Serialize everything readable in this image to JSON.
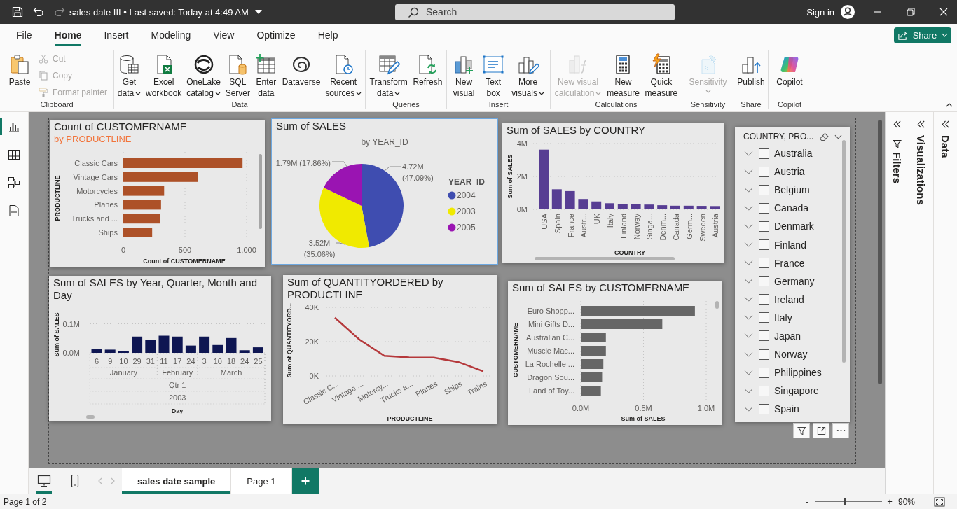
{
  "title_bar": {
    "document_title": "sales date III • Last saved: Today at 4:49 AM",
    "undo": {
      "disabled": false
    },
    "redo": {
      "disabled": true
    },
    "search": {
      "placeholder": "Search"
    },
    "sign_in": "Sign in"
  },
  "menu": {
    "tabs": [
      {
        "label": "File",
        "selected": false
      },
      {
        "label": "Home",
        "selected": true
      },
      {
        "label": "Insert",
        "selected": false
      },
      {
        "label": "Modeling",
        "selected": false
      },
      {
        "label": "View",
        "selected": false
      },
      {
        "label": "Optimize",
        "selected": false
      },
      {
        "label": "Help",
        "selected": false
      }
    ],
    "share_button": "Share"
  },
  "ribbon": {
    "groups": [
      {
        "label": "Clipboard",
        "items": [
          {
            "kind": "large",
            "label": "Paste",
            "dropdown": false,
            "disabled": false
          },
          {
            "kind": "small",
            "label": "Cut",
            "dropdown": false,
            "disabled": true
          },
          {
            "kind": "small",
            "label": "Copy",
            "dropdown": false,
            "disabled": true
          },
          {
            "kind": "small",
            "label": "Format painter",
            "dropdown": false,
            "disabled": true
          }
        ]
      },
      {
        "label": "Data",
        "items": [
          {
            "kind": "large",
            "label": "Get\ndata",
            "dropdown": true,
            "disabled": false
          },
          {
            "kind": "large",
            "label": "Excel\nworkbook",
            "dropdown": false,
            "disabled": false
          },
          {
            "kind": "large",
            "label": "OneLake\ncatalog",
            "dropdown": true,
            "disabled": false
          },
          {
            "kind": "large",
            "label": "SQL\nServer",
            "dropdown": false,
            "disabled": false
          },
          {
            "kind": "large",
            "label": "Enter\ndata",
            "dropdown": false,
            "disabled": false
          },
          {
            "kind": "large",
            "label": "Dataverse",
            "dropdown": false,
            "disabled": false
          },
          {
            "kind": "large",
            "label": "Recent\nsources",
            "dropdown": true,
            "disabled": false
          }
        ]
      },
      {
        "label": "Queries",
        "items": [
          {
            "kind": "large",
            "label": "Transform\ndata",
            "dropdown": true,
            "disabled": false
          },
          {
            "kind": "large",
            "label": "Refresh",
            "dropdown": false,
            "disabled": false
          }
        ]
      },
      {
        "label": "Insert",
        "items": [
          {
            "kind": "large",
            "label": "New\nvisual",
            "dropdown": false,
            "disabled": false
          },
          {
            "kind": "large",
            "label": "Text\nbox",
            "dropdown": false,
            "disabled": false
          },
          {
            "kind": "large",
            "label": "More\nvisuals",
            "dropdown": true,
            "disabled": false
          }
        ]
      },
      {
        "label": "Calculations",
        "items": [
          {
            "kind": "large",
            "label": "New visual\ncalculation",
            "dropdown": true,
            "disabled": true
          },
          {
            "kind": "large",
            "label": "New\nmeasure",
            "dropdown": false,
            "disabled": false
          },
          {
            "kind": "large",
            "label": "Quick\nmeasure",
            "dropdown": false,
            "disabled": false
          }
        ]
      },
      {
        "label": "Sensitivity",
        "items": [
          {
            "kind": "large",
            "label": "Sensitivity",
            "dropdown": true,
            "disabled": true
          }
        ]
      },
      {
        "label": "Share",
        "items": [
          {
            "kind": "large",
            "label": "Publish",
            "dropdown": false,
            "disabled": false
          }
        ]
      },
      {
        "label": "Copilot",
        "items": [
          {
            "kind": "large",
            "label": "Copilot",
            "dropdown": false,
            "disabled": false
          }
        ]
      }
    ]
  },
  "views": [
    {
      "selected": true
    },
    {
      "selected": false
    },
    {
      "selected": false
    },
    {
      "selected": false
    }
  ],
  "report_canvas": {
    "visuals": [
      {
        "selected": false,
        "chart_data": {
          "type": "bar",
          "orientation": "horizontal",
          "title": "Count of CUSTOMERNAME",
          "subtitle": "by PRODUCTLINE",
          "xlabel": "Count of CUSTOMERNAME",
          "ylabel": "PRODUCTLINE",
          "categories": [
            "Classic Cars",
            "Vintage Cars",
            "Motorcycles",
            "Planes",
            "Trucks and ...",
            "Ships"
          ],
          "values": [
            967,
            607,
            331,
            306,
            301,
            234
          ],
          "color": "#ad5128",
          "xlim": [
            0,
            1000
          ],
          "xticks": [
            0,
            500,
            {
              "value": 1000,
              "label": "1,000"
            }
          ],
          "grid": true
        }
      },
      {
        "selected": true,
        "chart_data": {
          "type": "pie",
          "title": "Sum of SALES",
          "subtitle": "by YEAR_ID",
          "legend_title": "YEAR_ID",
          "legend": "right",
          "categories": [
            "2004",
            "2003",
            "2005"
          ],
          "values": [
            4720000,
            3520000,
            1790000
          ],
          "colors": [
            "#3f4db0",
            "#f0ea00",
            "#9a14b2"
          ],
          "value_labels": [
            "4.72M (47.09%)",
            "3.52M (35.06%)",
            "1.79M (17.86%)"
          ]
        }
      },
      {
        "selected": false,
        "chart_data": {
          "type": "bar",
          "title": "Sum of SALES by COUNTRY",
          "xlabel": "COUNTRY",
          "ylabel": "Sum of SALES",
          "categories": [
            "USA",
            "Spain",
            "France",
            "Austr...",
            "UK",
            "Italy",
            "Finland",
            "Norway",
            "Singa...",
            "Denm...",
            "Canada",
            "Germ...",
            "Sweden",
            "Austria"
          ],
          "values": [
            3.63,
            1.22,
            1.11,
            0.63,
            0.48,
            0.37,
            0.33,
            0.31,
            0.29,
            0.25,
            0.22,
            0.22,
            0.21,
            0.2
          ],
          "color": "#573d93",
          "ylim": [
            0,
            4
          ],
          "yticks": [
            {
              "value": 0,
              "label": "0M"
            },
            {
              "value": 2,
              "label": "2M"
            },
            {
              "value": 4,
              "label": "4M"
            }
          ],
          "grid": true
        }
      },
      {
        "selected": false,
        "chart_data": {
          "type": "bar",
          "title": "Sum of SALES by Year, Quarter, Month and Day",
          "xlabel": "Day",
          "ylabel": "Sum of SALES",
          "categories": [
            "6",
            "9",
            "10",
            "29",
            "31",
            "11",
            "17",
            "24",
            "3",
            "10",
            "18",
            "24",
            "25"
          ],
          "annotations": [
            "January",
            "February",
            "March",
            "Qtr 1",
            "2003"
          ],
          "values": [
            0.012,
            0.011,
            0.007,
            0.056,
            0.044,
            0.059,
            0.056,
            0.025,
            0.056,
            0.027,
            0.051,
            0.009,
            0.019
          ],
          "color": "#0e1652",
          "ylim": [
            0,
            0.1
          ],
          "yticks": [
            {
              "value": 0,
              "label": "0.0M"
            },
            {
              "value": 0.1,
              "label": "0.1M"
            }
          ],
          "grid": true
        }
      },
      {
        "selected": false,
        "chart_data": {
          "type": "line",
          "title": "Sum of QUANTITYORDERED by PRODUCTLINE",
          "xlabel": "PRODUCTLINE",
          "ylabel": "Sum of QUANTITYORD...",
          "categories": [
            "Classic C...",
            "Vintage ...",
            "Motorcy...",
            "Trucks a...",
            "Planes",
            "Ships",
            "Trains"
          ],
          "values": [
            34000,
            21100,
            11700,
            10800,
            10700,
            8100,
            2700
          ],
          "color": "#b5383b",
          "ylim": [
            0,
            40000
          ],
          "yticks": [
            {
              "value": 0,
              "label": "0K"
            },
            {
              "value": 20000,
              "label": "20K"
            },
            {
              "value": 40000,
              "label": "40K"
            }
          ],
          "grid": true
        }
      },
      {
        "selected": false,
        "chart_data": {
          "type": "bar",
          "orientation": "horizontal",
          "title": "Sum of SALES by CUSTOMERNAME",
          "xlabel": "Sum of SALES",
          "ylabel": "CUSTOMERNAME",
          "categories": [
            "Euro Shopp...",
            "Mini Gifts D...",
            "Australian C...",
            "Muscle Mac...",
            "La Rochelle ...",
            "Dragon Sou...",
            "Land of Toy..."
          ],
          "values": [
            0.91,
            0.65,
            0.2,
            0.2,
            0.18,
            0.17,
            0.16
          ],
          "color": "#666666",
          "xlim": [
            0,
            1
          ],
          "xticks": [
            {
              "value": 0,
              "label": "0.0M"
            },
            {
              "value": 0.5,
              "label": "0.5M"
            },
            {
              "value": 1,
              "label": "1.0M"
            }
          ],
          "grid": true
        }
      }
    ],
    "slicer": {
      "header": "COUNTRY, PRO...",
      "header_visible": true,
      "items": [
        {
          "label": "Australia",
          "expanded": false,
          "checked": false
        },
        {
          "label": "Austria",
          "expanded": false,
          "checked": false
        },
        {
          "label": "Belgium",
          "expanded": false,
          "checked": false
        },
        {
          "label": "Canada",
          "expanded": false,
          "checked": false
        },
        {
          "label": "Denmark",
          "expanded": false,
          "checked": false
        },
        {
          "label": "Finland",
          "expanded": false,
          "checked": false
        },
        {
          "label": "France",
          "expanded": false,
          "checked": false
        },
        {
          "label": "Germany",
          "expanded": false,
          "checked": false
        },
        {
          "label": "Ireland",
          "expanded": false,
          "checked": false
        },
        {
          "label": "Italy",
          "expanded": false,
          "checked": false
        },
        {
          "label": "Japan",
          "expanded": false,
          "checked": false
        },
        {
          "label": "Norway",
          "expanded": false,
          "checked": false
        },
        {
          "label": "Philippines",
          "expanded": false,
          "checked": false
        },
        {
          "label": "Singapore",
          "expanded": false,
          "checked": false
        },
        {
          "label": "Spain",
          "expanded": false,
          "checked": false
        }
      ]
    }
  },
  "panes": [
    {
      "kind": "filters",
      "label": "Filters"
    },
    {
      "kind": "visualizations",
      "label": "Visualizations"
    },
    {
      "kind": "data",
      "label": "Data"
    }
  ],
  "page_navigation": {
    "layouts": [
      {
        "selected": true
      },
      {
        "selected": false
      }
    ],
    "pages": [
      {
        "label": "sales date sample",
        "selected": true
      },
      {
        "label": "Page 1",
        "selected": false
      }
    ]
  },
  "status_bar": {
    "page_indicator": "Page 1 of 2",
    "zoom": {
      "minus": "-",
      "plus": "+",
      "level": 0.45,
      "reading": "90%"
    }
  }
}
